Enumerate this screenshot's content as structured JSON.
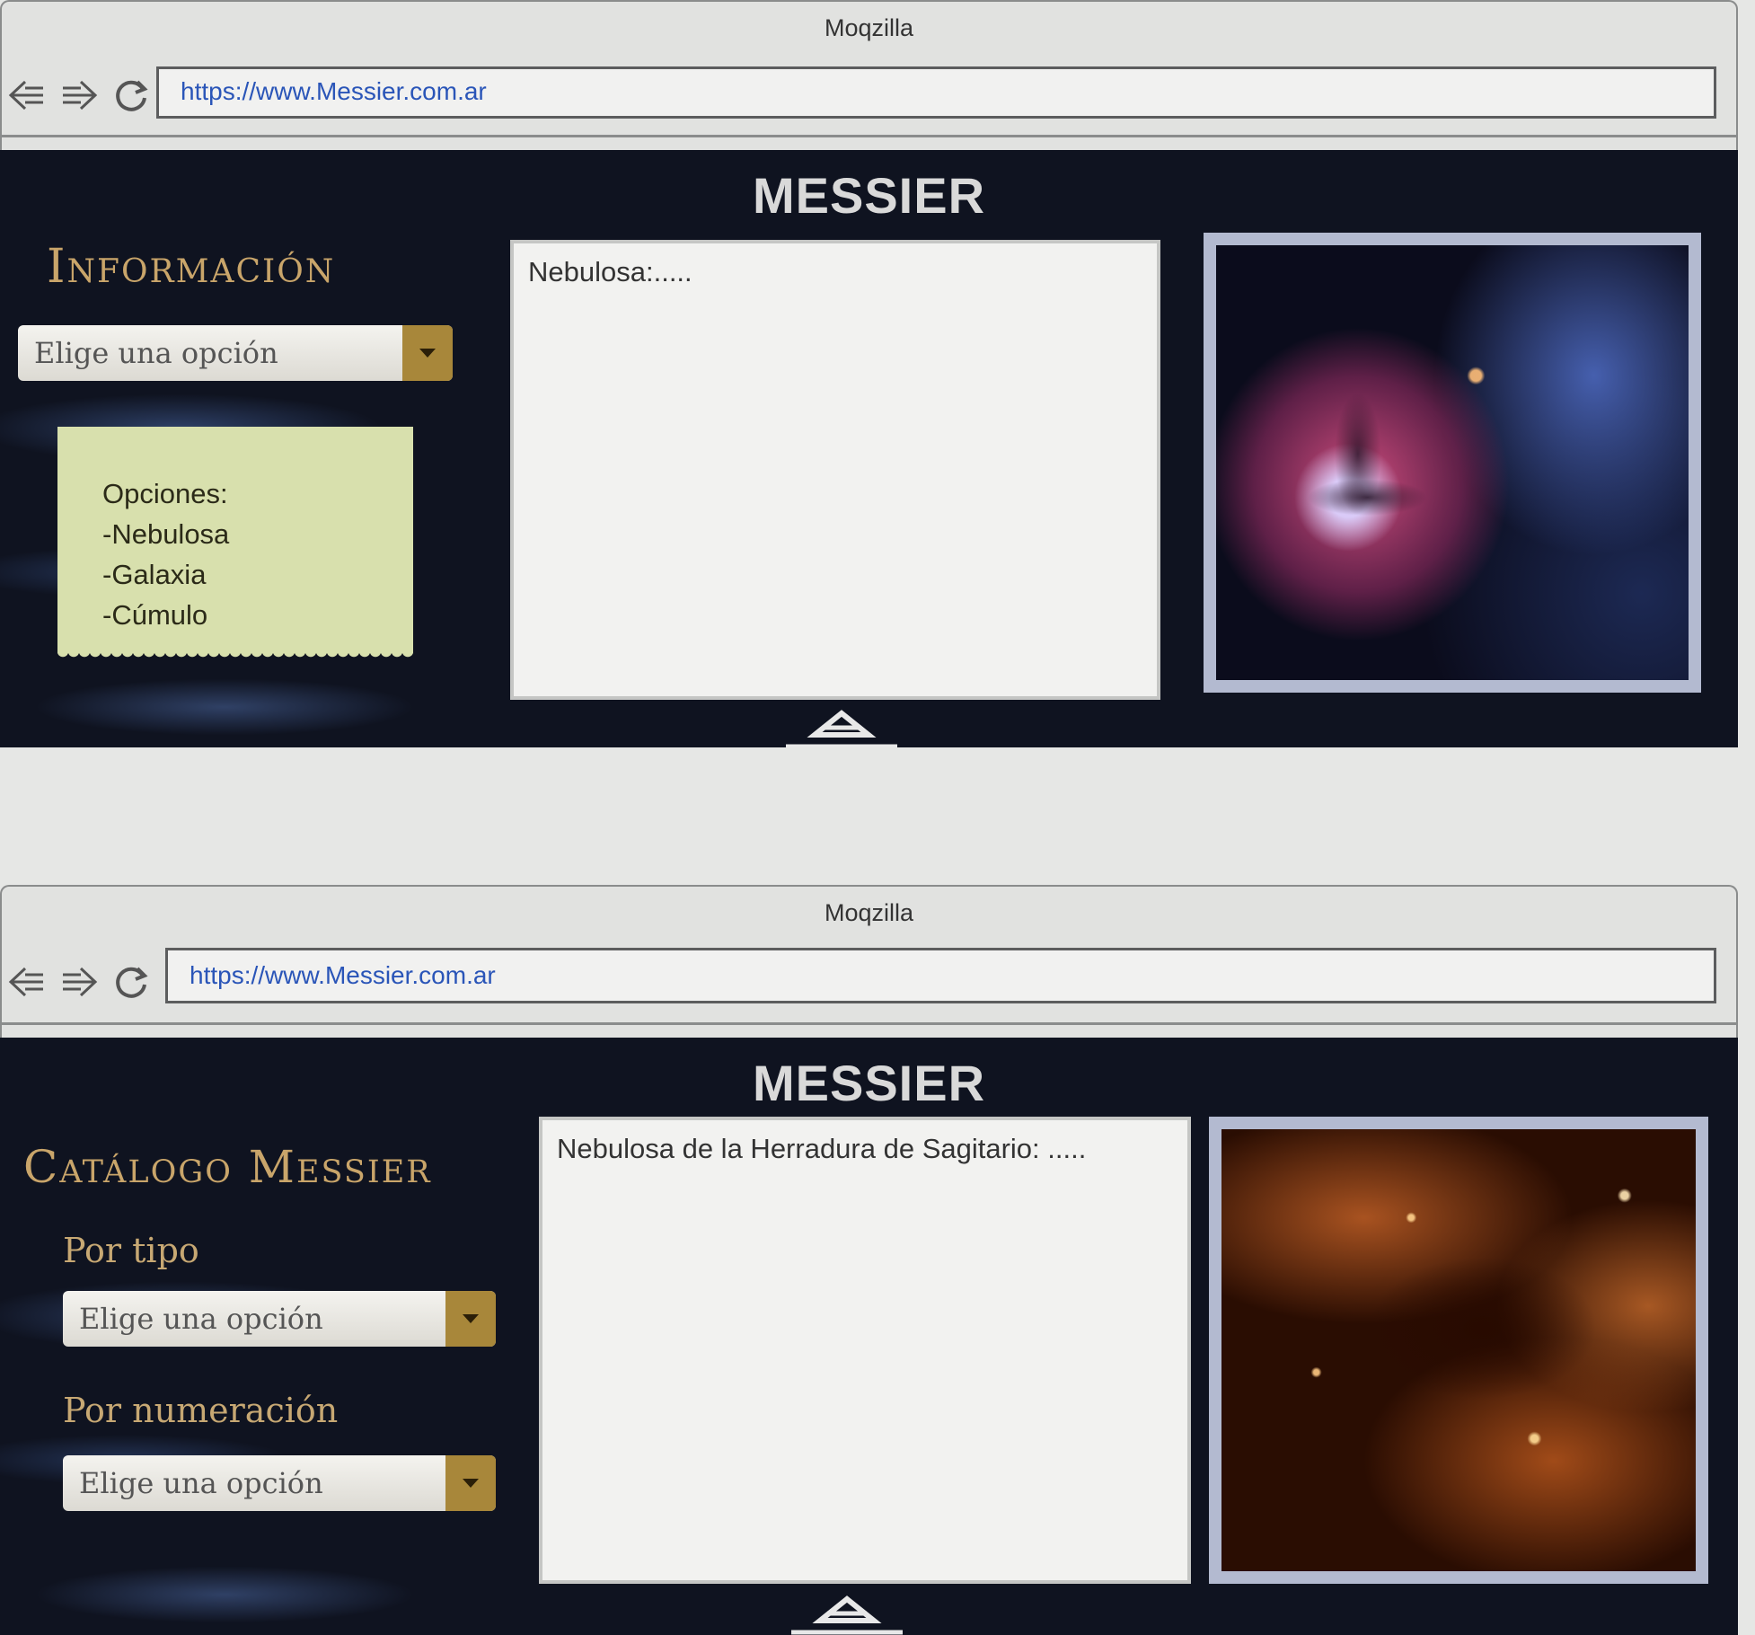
{
  "window1": {
    "title": "Moqzilla",
    "url": "https://www.Messier.com.ar",
    "brand": "MESSIER",
    "heading": "Información",
    "select": {
      "value": "Elige una opción"
    },
    "note": {
      "lines": [
        "Opciones:",
        "-Nebulosa",
        "-Galaxia",
        "-Cúmulo"
      ]
    },
    "textbox": "Nebulosa:.....",
    "image_icon": "nebula-image"
  },
  "window2": {
    "title": "Moqzilla",
    "url": "https://www.Messier.com.ar",
    "brand": "MESSIER",
    "heading": "Catálogo Messier",
    "by_type": {
      "label": "Por tipo",
      "value": "Elige una opción"
    },
    "by_number": {
      "label": "Por numeración",
      "value": "Elige una opción"
    },
    "textbox": "Nebulosa de la Herradura de Sagitario: .....",
    "image_icon": "star-cluster-image"
  },
  "icons": [
    "back-arrow-icon",
    "forward-arrow-icon",
    "reload-icon",
    "chevron-down-icon",
    "scroll-up-icon"
  ],
  "colors": {
    "page_bg": "#0f1320",
    "heading_gold": "#c9a56a",
    "select_arrow": "#a8873a",
    "note_bg": "#d8e0ad",
    "url_blue": "#2a55b8"
  }
}
